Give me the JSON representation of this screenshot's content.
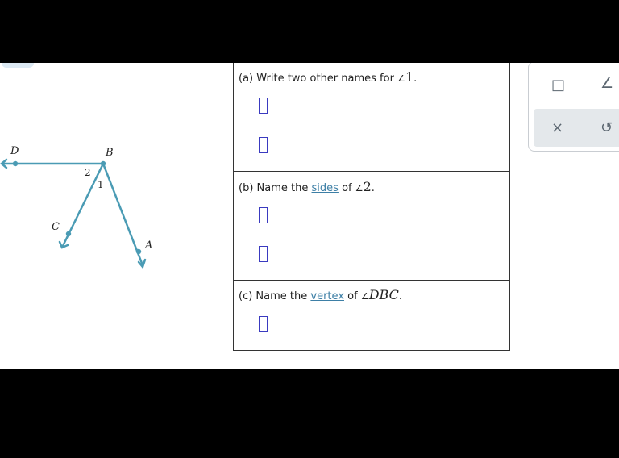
{
  "figure": {
    "points": {
      "D": "D",
      "B": "B",
      "C": "C",
      "A": "A"
    },
    "angles": {
      "two": "2",
      "one": "1"
    },
    "line_color": "#4a9bb4"
  },
  "questions": {
    "a": {
      "prefix": "(a) Write two other names for",
      "angle_symbol": "∠",
      "angle_name": "1",
      "suffix": "."
    },
    "b": {
      "prefix": "(b) Name the",
      "link": "sides",
      "middle": "of",
      "angle_symbol": "∠",
      "angle_name": "2",
      "suffix": "."
    },
    "c": {
      "prefix": "(c) Name the",
      "link": "vertex",
      "middle": "of",
      "angle_symbol": "∠",
      "angle_name": "DBC",
      "suffix": "."
    }
  },
  "tools": {
    "icons": [
      "vector-box-icon",
      "angle-icon",
      "clear-icon",
      "undo-icon"
    ],
    "glyphs": {
      "vector_box": "□",
      "angle": "∠",
      "clear": "×",
      "undo": "↺"
    }
  }
}
